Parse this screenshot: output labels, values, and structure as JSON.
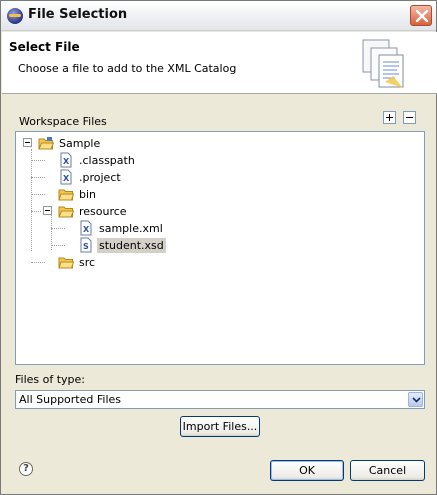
{
  "window": {
    "title": "File Selection"
  },
  "header": {
    "title": "Select File",
    "description": "Choose a file to add to the XML Catalog"
  },
  "workspace": {
    "label": "Workspace Files",
    "tree": [
      {
        "label": "Sample",
        "icon": "project-folder-icon",
        "level": 0,
        "expanded": true
      },
      {
        "label": ".classpath",
        "icon": "xml-file-icon",
        "level": 1
      },
      {
        "label": ".project",
        "icon": "xml-file-icon",
        "level": 1
      },
      {
        "label": "bin",
        "icon": "folder-icon",
        "level": 1
      },
      {
        "label": "resource",
        "icon": "folder-open-icon",
        "level": 1,
        "expanded": true
      },
      {
        "label": "sample.xml",
        "icon": "xml-file-icon",
        "level": 2
      },
      {
        "label": "student.xsd",
        "icon": "xsd-file-icon",
        "level": 2,
        "selected": true
      },
      {
        "label": "src",
        "icon": "folder-icon",
        "level": 1
      }
    ]
  },
  "filter": {
    "label": "Files of type:",
    "value": "All Supported Files"
  },
  "buttons": {
    "import": "Import Files...",
    "ok": "OK",
    "cancel": "Cancel"
  },
  "help": {
    "glyph": "?"
  },
  "colors": {
    "dialog_bg": "#ece9d8",
    "tree_border": "#7f9db9",
    "selection_bg": "#d4d0c8",
    "folder": "#f2c94c"
  }
}
